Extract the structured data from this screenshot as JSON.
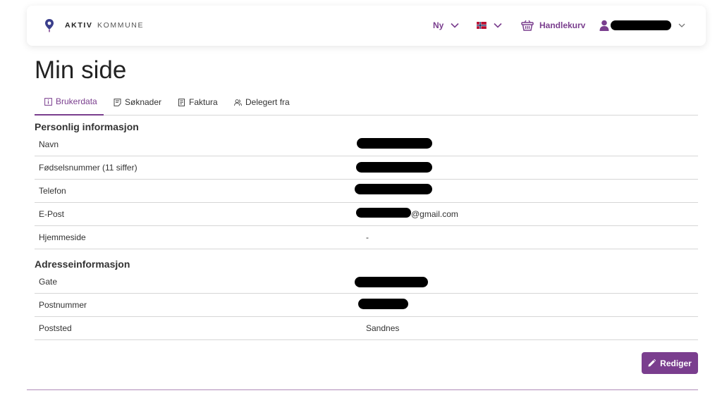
{
  "header": {
    "brand_bold": "AKTIV",
    "brand_light": "KOMMUNE",
    "new_label": "Ny",
    "cart_label": "Handlekurv"
  },
  "page": {
    "title": "Min side"
  },
  "tabs": [
    {
      "label": "Brukerdata",
      "icon": "info-icon",
      "active": true
    },
    {
      "label": "Søknader",
      "icon": "application-icon",
      "active": false
    },
    {
      "label": "Faktura",
      "icon": "invoice-icon",
      "active": false
    },
    {
      "label": "Delegert fra",
      "icon": "users-icon",
      "active": false
    }
  ],
  "personal": {
    "title": "Personlig informasjon",
    "rows": [
      {
        "label": "Navn",
        "value": ""
      },
      {
        "label": "Fødselsnummer (11 siffer)",
        "value": ""
      },
      {
        "label": "Telefon",
        "value": ""
      },
      {
        "label": "E-Post",
        "value": "@gmail.com"
      },
      {
        "label": "Hjemmeside",
        "value": "-"
      }
    ]
  },
  "address": {
    "title": "Adresseinformasjon",
    "rows": [
      {
        "label": "Gate",
        "value": ""
      },
      {
        "label": "Postnummer",
        "value": ""
      },
      {
        "label": "Poststed",
        "value": "Sandnes"
      }
    ]
  },
  "actions": {
    "edit_label": "Rediger"
  },
  "colors": {
    "accent": "#7a3e8e",
    "divider": "#d6d6d6",
    "redaction": "#000000"
  }
}
